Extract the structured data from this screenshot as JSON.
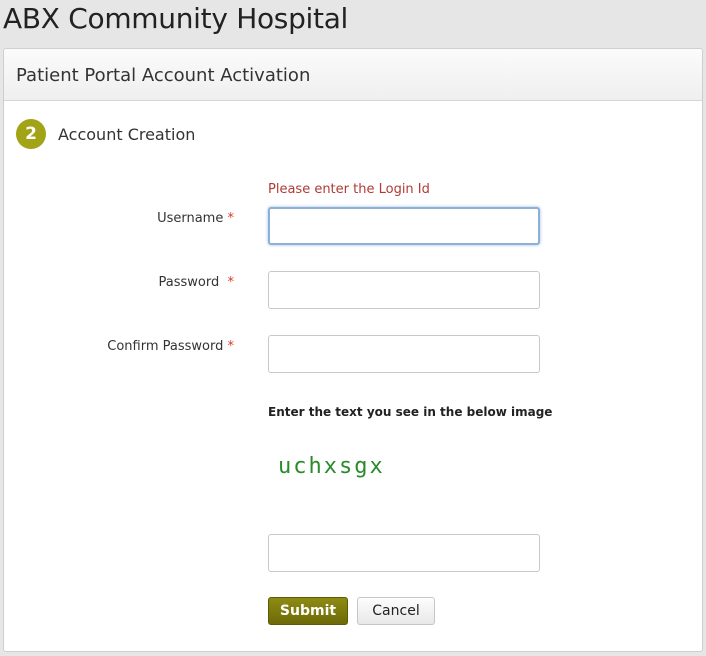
{
  "app": {
    "hospital_name": "ABX Community Hospital"
  },
  "panel": {
    "title": "Patient Portal Account Activation"
  },
  "step": {
    "number": "2",
    "title": "Account Creation"
  },
  "form": {
    "error_message": "Please enter the Login Id",
    "required_marker": "*",
    "fields": [
      {
        "label": "Username",
        "value": ""
      },
      {
        "label": "Password",
        "value": ""
      },
      {
        "label": "Confirm Password",
        "value": ""
      }
    ],
    "captcha_prompt": "Enter the text you see in the below image",
    "captcha_text": "uchxsgx",
    "captcha_value": ""
  },
  "buttons": {
    "submit": "Submit",
    "cancel": "Cancel"
  },
  "colors": {
    "accent": "#a2a316",
    "submit_bg": "#7d7a0e",
    "error": "#b03a36",
    "required": "#d9392c",
    "captcha": "#2b8a2b"
  }
}
